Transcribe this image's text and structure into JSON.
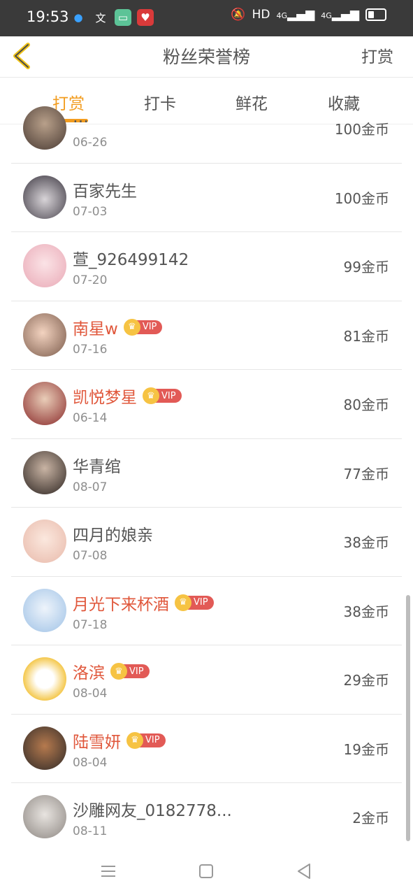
{
  "status": {
    "time": "19:53",
    "network": "HD",
    "signal1": "4G",
    "signal2": "4G"
  },
  "header": {
    "title": "粉丝荣誉榜",
    "action": "打赏"
  },
  "tabs": [
    {
      "label": "打赏",
      "active": true
    },
    {
      "label": "打卡",
      "active": false
    },
    {
      "label": "鲜花",
      "active": false
    },
    {
      "label": "收藏",
      "active": false
    }
  ],
  "vip_label": "VIP",
  "colors": {
    "accent": "#f29c1f",
    "vip_name": "#e0573b",
    "vip_badge": "#e25a56"
  },
  "rows": [
    {
      "name": "…",
      "date": "06-26",
      "coins": "100金币",
      "vip": false
    },
    {
      "name": "百家先生",
      "date": "07-03",
      "coins": "100金币",
      "vip": false
    },
    {
      "name": "萱_926499142",
      "date": "07-20",
      "coins": "99金币",
      "vip": false
    },
    {
      "name": "南星w",
      "date": "07-16",
      "coins": "81金币",
      "vip": true
    },
    {
      "name": "凯悦梦星",
      "date": "06-14",
      "coins": "80金币",
      "vip": true
    },
    {
      "name": "华青绾",
      "date": "08-07",
      "coins": "77金币",
      "vip": false
    },
    {
      "name": "四月的娘亲",
      "date": "07-08",
      "coins": "38金币",
      "vip": false
    },
    {
      "name": "月光下来杯酒",
      "date": "07-18",
      "coins": "38金币",
      "vip": true
    },
    {
      "name": "洛滨",
      "date": "08-04",
      "coins": "29金币",
      "vip": true
    },
    {
      "name": "陆雪妍",
      "date": "08-04",
      "coins": "19金币",
      "vip": true
    },
    {
      "name": "沙雕网友_0182778...",
      "date": "08-11",
      "coins": "2金币",
      "vip": false
    }
  ]
}
